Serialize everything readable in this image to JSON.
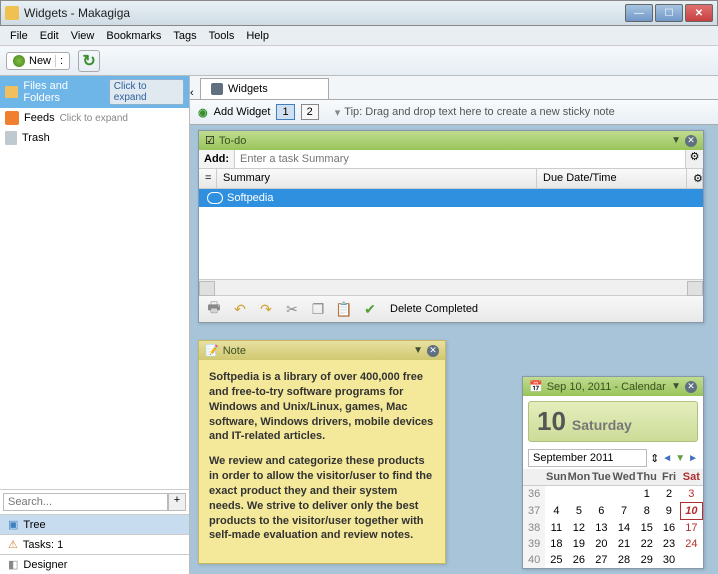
{
  "window": {
    "title": "Widgets - Makagiga"
  },
  "menu": {
    "file": "File",
    "edit": "Edit",
    "view": "View",
    "bookmarks": "Bookmarks",
    "tags": "Tags",
    "tools": "Tools",
    "help": "Help"
  },
  "toolbar": {
    "new": "New",
    "spinner": ":"
  },
  "sidebar": {
    "files_folders": "Files and Folders",
    "click_expand": "Click to expand",
    "feeds": "Feeds",
    "feeds_expand": "Click to expand",
    "trash": "Trash",
    "search_placeholder": "Search...",
    "tree": "Tree",
    "tasks": "Tasks: 1",
    "designer": "Designer"
  },
  "tab": {
    "label": "Widgets"
  },
  "subbar": {
    "add_widget": "Add Widget",
    "p1": "1",
    "p2": "2",
    "tip": "Tip: Drag and drop text here to create a new sticky note"
  },
  "todo": {
    "title": "To-do",
    "add_label": "Add:",
    "add_placeholder": "Enter a task Summary",
    "col_check": "=",
    "col_summary": "Summary",
    "col_due": "Due Date/Time",
    "rows": [
      {
        "summary": "Softpedia"
      }
    ],
    "delete_completed": "Delete Completed"
  },
  "note": {
    "title": "Note",
    "p1": "Softpedia is a library of over 400,000 free and free-to-try software programs for Windows and Unix/Linux, games, Mac software, Windows drivers, mobile devices and IT-related articles.",
    "p2": "We review and categorize these products in order to allow the visitor/user to find the exact product they and their system needs. We strive to deliver only the best products to the visitor/user together with self-made evaluation and review notes."
  },
  "calendar": {
    "header": "Sep 10, 2011 - Calendar",
    "day_num": "10",
    "day_name": "Saturday",
    "month": "September 2011",
    "dow": [
      "Sun",
      "Mon",
      "Tue",
      "Wed",
      "Thu",
      "Fri",
      "Sat"
    ],
    "weeks": [
      {
        "wk": "36",
        "d": [
          "",
          "",
          "",
          "",
          "1",
          "2",
          "3"
        ]
      },
      {
        "wk": "37",
        "d": [
          "4",
          "5",
          "6",
          "7",
          "8",
          "9",
          "10"
        ]
      },
      {
        "wk": "38",
        "d": [
          "11",
          "12",
          "13",
          "14",
          "15",
          "16",
          "17"
        ]
      },
      {
        "wk": "39",
        "d": [
          "18",
          "19",
          "20",
          "21",
          "22",
          "23",
          "24"
        ]
      },
      {
        "wk": "40",
        "d": [
          "25",
          "26",
          "27",
          "28",
          "29",
          "30",
          ""
        ]
      }
    ],
    "today": "10"
  }
}
